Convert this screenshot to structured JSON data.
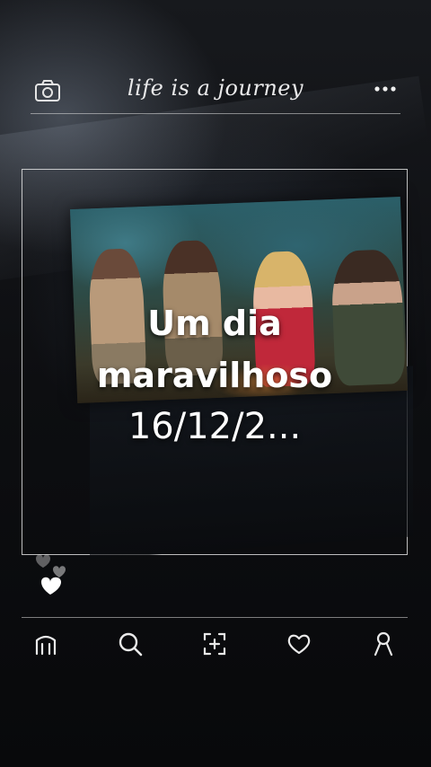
{
  "top_bar": {
    "title": "life is a journey",
    "left_icon": "camera-icon",
    "right_icon": "more-dots-icon"
  },
  "caption": {
    "line1": "Um dia",
    "line2": "maravilhoso",
    "line3": "16/12/2..."
  },
  "bottom_nav": {
    "items": [
      {
        "icon": "home-icon"
      },
      {
        "icon": "search-icon"
      },
      {
        "icon": "add-post-icon"
      },
      {
        "icon": "heart-icon"
      },
      {
        "icon": "profile-icon"
      }
    ]
  },
  "colors": {
    "background": "#0b0c0f",
    "line": "#dcdcdc",
    "text": "#ffffff"
  }
}
